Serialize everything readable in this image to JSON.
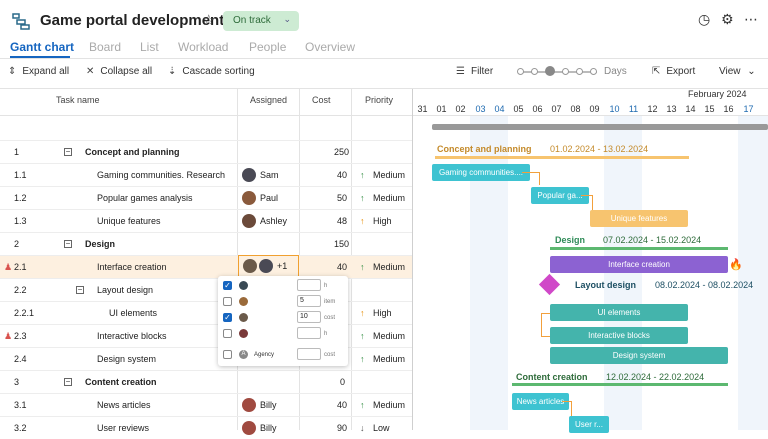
{
  "header": {
    "title": "Game portal development",
    "status": "On track",
    "tabs": [
      {
        "label": "Gantt chart"
      },
      {
        "label": "Board"
      },
      {
        "label": "List"
      },
      {
        "label": "Workload"
      },
      {
        "label": "People"
      },
      {
        "label": "Overview"
      }
    ]
  },
  "toolbar": {
    "expand": "Expand all",
    "collapse": "Collapse all",
    "cascade": "Cascade sorting",
    "filter": "Filter",
    "zoom": "Days",
    "export": "Export",
    "view": "View"
  },
  "columns": {
    "task": "Task name",
    "assigned": "Assigned",
    "cost": "Cost",
    "priority": "Priority"
  },
  "rows": [
    {
      "num": "1",
      "name": "Concept and planning",
      "cost": "250"
    },
    {
      "num": "1.1",
      "name": "Gaming communities. Research",
      "assignee": "Sam",
      "cost": "40",
      "priority": "Medium"
    },
    {
      "num": "1.2",
      "name": "Popular games analysis",
      "assignee": "Paul",
      "cost": "50",
      "priority": "Medium"
    },
    {
      "num": "1.3",
      "name": "Unique features",
      "assignee": "Ashley",
      "cost": "48",
      "priority": "High"
    },
    {
      "num": "2",
      "name": "Design",
      "cost": "150"
    },
    {
      "num": "2.1",
      "name": "Interface creation",
      "assignee": "+1",
      "cost": "40",
      "priority": "Medium"
    },
    {
      "num": "2.2",
      "name": "Layout design"
    },
    {
      "num": "2.2.1",
      "name": "UI elements",
      "priority": "High"
    },
    {
      "num": "2.3",
      "name": "Interactive blocks",
      "priority": "Medium"
    },
    {
      "num": "2.4",
      "name": "Design system",
      "priority": "Medium"
    },
    {
      "num": "3",
      "name": "Content creation",
      "cost": "0"
    },
    {
      "num": "3.1",
      "name": "News articles",
      "assignee": "Billy",
      "cost": "40",
      "priority": "Medium"
    },
    {
      "num": "3.2",
      "name": "User reviews",
      "assignee": "Billy",
      "cost": "90",
      "priority": "Low"
    }
  ],
  "popup": {
    "rows": [
      {
        "value": "",
        "unit": "h"
      },
      {
        "value": "5",
        "unit": "item"
      },
      {
        "value": "10",
        "unit": "cost"
      },
      {
        "value": "",
        "unit": "h"
      },
      {
        "label": "Agency",
        "value": "",
        "unit": "cost"
      }
    ]
  },
  "gantt": {
    "month": "February 2024",
    "days": [
      "31",
      "01",
      "02",
      "03",
      "04",
      "05",
      "06",
      "07",
      "08",
      "09",
      "10",
      "11",
      "12",
      "13",
      "14",
      "15",
      "16",
      "17"
    ],
    "bars": {
      "concept_label": "Concept and planning",
      "concept_dates": "01.02.2024 - 13.02.2024",
      "gaming": "Gaming communities....",
      "popular": "Popular ga...",
      "unique": "Unique features",
      "design_label": "Design",
      "design_dates": "07.02.2024 - 15.02.2024",
      "interface": "Interface creation",
      "layout_label": "Layout design",
      "layout_dates": "08.02.2024 - 08.02.2024",
      "ui": "UI elements",
      "interactive": "Interactive blocks",
      "designsys": "Design system",
      "content_label": "Content creation",
      "content_dates": "12.02.2024 - 22.02.2024",
      "news": "News articles",
      "user": "User r..."
    }
  },
  "colors": {
    "accent": "#1565c0",
    "status_bg": "#cdebd3",
    "orange": "#f7c46f",
    "teal": "#47b8b0",
    "purple": "#8c62d2",
    "cyan": "#3ec3d1"
  }
}
